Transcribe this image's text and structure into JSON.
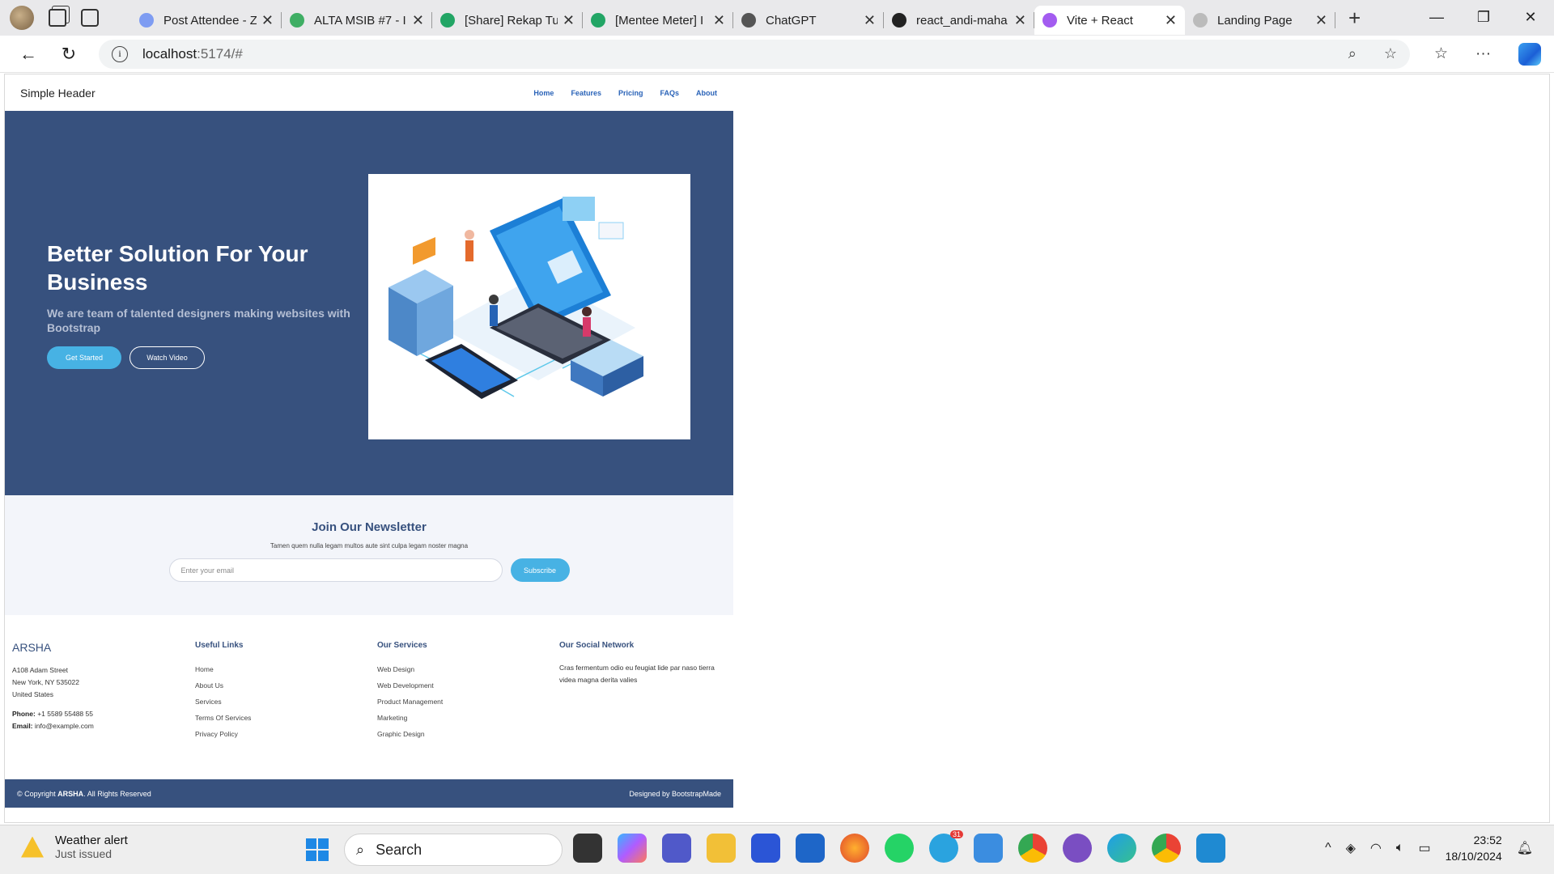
{
  "browser": {
    "tabs": [
      {
        "title": "Post Attendee - Z",
        "color": "#7e9cf2"
      },
      {
        "title": "ALTA MSIB #7 - I",
        "color": "#3fae64"
      },
      {
        "title": "[Share] Rekap Tu",
        "color": "#22a565"
      },
      {
        "title": "[Mentee Meter] I",
        "color": "#22a565"
      },
      {
        "title": "ChatGPT",
        "color": "#555555"
      },
      {
        "title": "react_andi-maha",
        "color": "#222222"
      },
      {
        "title": "Vite + React",
        "color": "#a35cf0"
      },
      {
        "title": "Landing Page",
        "color": "#bbbbbb"
      }
    ],
    "url_host": "localhost",
    "url_path": ":5174/#"
  },
  "site": {
    "brand": "Simple Header",
    "nav": [
      "Home",
      "Features",
      "Pricing",
      "FAQs",
      "About"
    ],
    "hero": {
      "title": "Better Solution For Your Business",
      "subtitle": "We are team of talented designers making websites with Bootstrap",
      "primary_btn": "Get Started",
      "secondary_btn": "Watch Video"
    },
    "newsletter": {
      "title": "Join Our Newsletter",
      "subtitle": "Tamen quem nulla legam multos aute sint culpa legam noster magna",
      "placeholder": "Enter your email",
      "button": "Subscribe"
    },
    "footer": {
      "brand": "ARSHA",
      "address": [
        "A108 Adam Street",
        "New York, NY 535022",
        "United States"
      ],
      "phone_label": "Phone:",
      "phone": "+1 5589 55488 55",
      "email_label": "Email:",
      "email": "info@example.com",
      "useful_links_title": "Useful Links",
      "useful_links": [
        "Home",
        "About Us",
        "Services",
        "Terms Of Services",
        "Privacy Policy"
      ],
      "services_title": "Our Services",
      "services": [
        "Web Design",
        "Web Development",
        "Product Management",
        "Marketing",
        "Graphic Design"
      ],
      "social_title": "Our Social Network",
      "social_text": "Cras fermentum odio eu feugiat lide par naso tierra videa magna derita valies",
      "copyright_pre": "© Copyright",
      "copyright_brand": "ARSHA",
      "copyright_post": "All Rights Reserved",
      "designed": "Designed by BootstrapMade"
    }
  },
  "taskbar": {
    "weather_title": "Weather alert",
    "weather_sub": "Just issued",
    "search": "Search",
    "time": "23:52",
    "date": "18/10/2024",
    "telegram_badge": "31"
  }
}
